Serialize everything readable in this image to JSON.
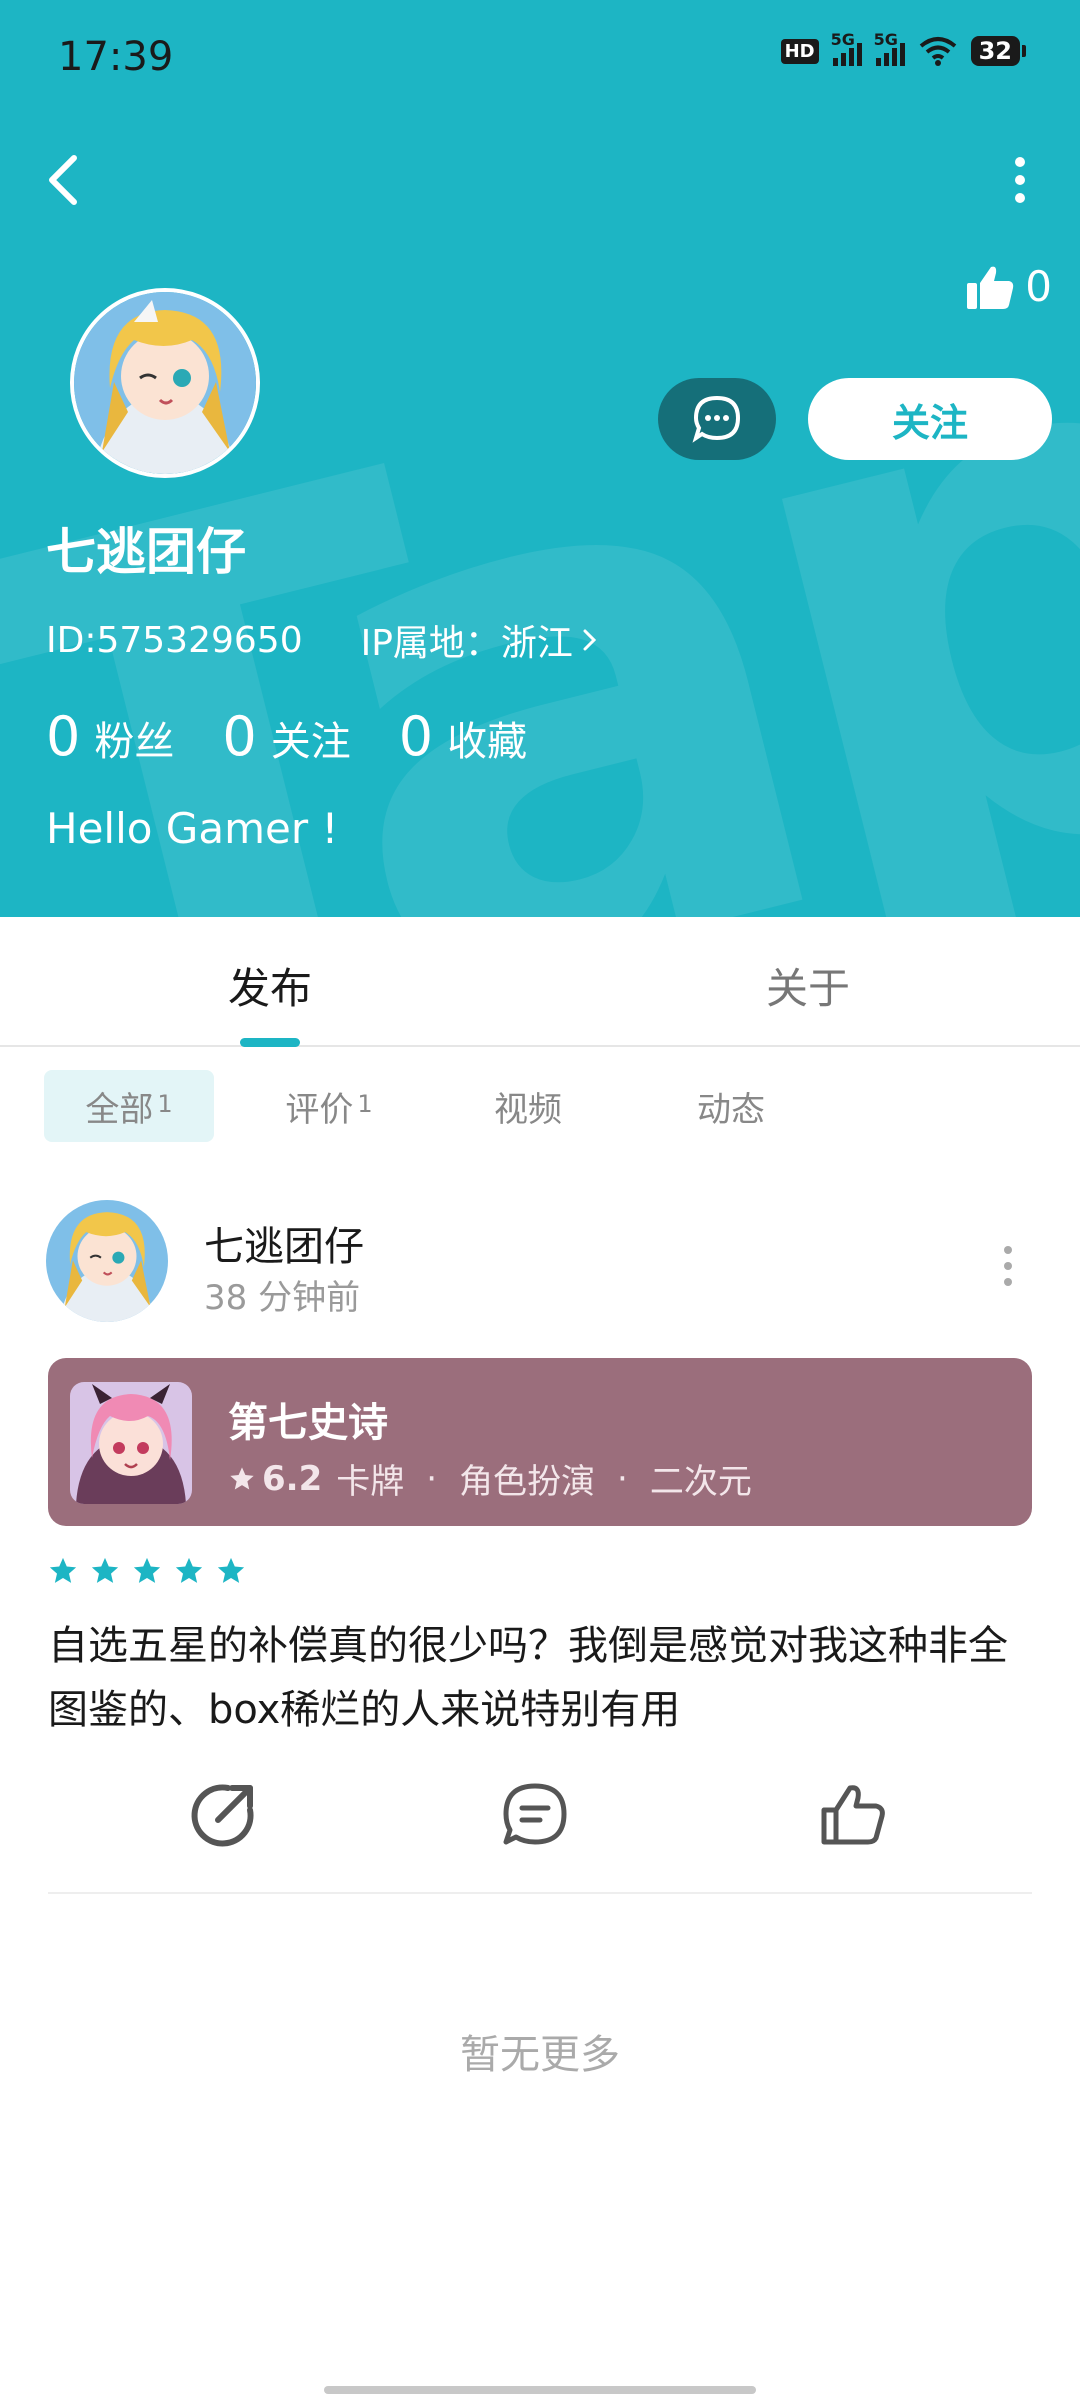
{
  "status_bar": {
    "time": "17:39",
    "hd_label": "HD",
    "sig1_label": "5G",
    "sig2_label": "5G",
    "battery": "32"
  },
  "header": {
    "bg_color": "#1db5c4",
    "watermark": "TapTap",
    "like_count": "0"
  },
  "profile": {
    "name": "七逃团仔",
    "id_text": "ID:575329650",
    "ip_text": "IP属地：浙江",
    "follow_label": "关注",
    "stats": [
      {
        "num": "0",
        "label": "粉丝"
      },
      {
        "num": "0",
        "label": "关注"
      },
      {
        "num": "0",
        "label": "收藏"
      }
    ],
    "bio": "Hello Gamer !"
  },
  "tabs": {
    "publish": "发布",
    "about": "关于"
  },
  "filters": {
    "all": "全部",
    "all_count": "1",
    "review": "评价",
    "review_count": "1",
    "video": "视频",
    "dynamic": "动态"
  },
  "post": {
    "author": "七逃团仔",
    "time": "38 分钟前",
    "game": {
      "name": "第七史诗",
      "rating": "6.2",
      "tags": [
        "卡牌",
        "角色扮演",
        "二次元"
      ],
      "card_color": "#9b6e7c"
    },
    "star_rating": 5,
    "text": "自选五星的补偿真的很少吗？我倒是感觉对我这种非全图鉴的、box稀烂的人来说特别有用"
  },
  "footer": {
    "no_more": "暂无更多"
  }
}
